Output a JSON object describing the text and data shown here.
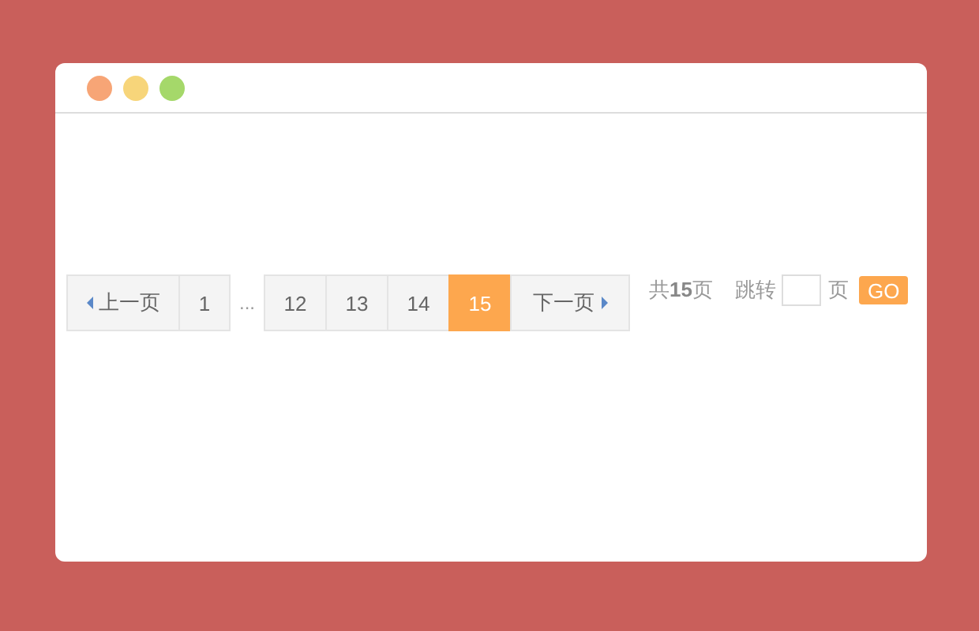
{
  "window": {
    "controls": [
      {
        "color": "#f7a576"
      },
      {
        "color": "#f7d57a"
      },
      {
        "color": "#a5d86a"
      }
    ]
  },
  "pagination": [
    {
      "kind": "prev",
      "label": "上一页",
      "selected": false
    },
    {
      "kind": "page",
      "label": "1",
      "selected": false
    },
    {
      "kind": "ellipsis",
      "label": "..."
    },
    {
      "kind": "page",
      "label": "12",
      "selected": false
    },
    {
      "kind": "page",
      "label": "13",
      "selected": false
    },
    {
      "kind": "page",
      "label": "14",
      "selected": false
    },
    {
      "kind": "page",
      "label": "15",
      "selected": true
    },
    {
      "kind": "next",
      "label": "下一页",
      "selected": false
    }
  ],
  "total": "共**15**页",
  "jump": {
    "label": "跳转",
    "unit": "页",
    "button": "GO"
  }
}
